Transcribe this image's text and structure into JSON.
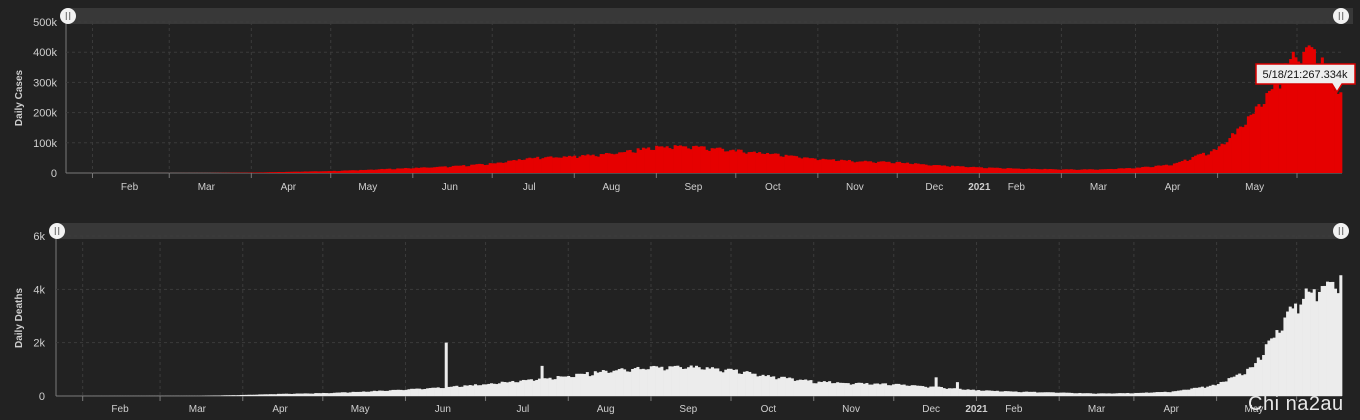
{
  "chart_data": [
    {
      "type": "bar",
      "ylabel": "Daily Cases",
      "ylim": [
        0,
        500000
      ],
      "yticks": [
        {
          "v": 0,
          "label": "0"
        },
        {
          "v": 100000,
          "label": "100k"
        },
        {
          "v": 200000,
          "label": "200k"
        },
        {
          "v": 300000,
          "label": "300k"
        },
        {
          "v": 400000,
          "label": "400k"
        },
        {
          "v": 500000,
          "label": "500k"
        }
      ],
      "xticks": [
        "Feb",
        "Mar",
        "Apr",
        "May",
        "Jun",
        "Jul",
        "Aug",
        "Sep",
        "Oct",
        "Nov",
        "Dec",
        "2021",
        "Feb",
        "Mar",
        "Apr",
        "May"
      ],
      "xrange": [
        "2020-01-22",
        "2021-05-18"
      ],
      "grid": true,
      "color": "#e60000",
      "tooltip": "5/18/21:267.334k",
      "series": [
        {
          "x": "2020-01-22",
          "y": 0
        },
        {
          "x": "2020-03-01",
          "y": 100
        },
        {
          "x": "2020-03-15",
          "y": 300
        },
        {
          "x": "2020-04-01",
          "y": 1500
        },
        {
          "x": "2020-04-15",
          "y": 4000
        },
        {
          "x": "2020-05-01",
          "y": 6500
        },
        {
          "x": "2020-05-15",
          "y": 11000
        },
        {
          "x": "2020-06-01",
          "y": 17000
        },
        {
          "x": "2020-06-15",
          "y": 22000
        },
        {
          "x": "2020-07-01",
          "y": 32000
        },
        {
          "x": "2020-07-15",
          "y": 50000
        },
        {
          "x": "2020-08-01",
          "y": 57000
        },
        {
          "x": "2020-08-15",
          "y": 65000
        },
        {
          "x": "2020-08-25",
          "y": 78000
        },
        {
          "x": "2020-09-01",
          "y": 88000
        },
        {
          "x": "2020-09-15",
          "y": 90000
        },
        {
          "x": "2020-10-01",
          "y": 75000
        },
        {
          "x": "2020-10-15",
          "y": 65000
        },
        {
          "x": "2020-11-01",
          "y": 48000
        },
        {
          "x": "2020-11-15",
          "y": 40000
        },
        {
          "x": "2020-12-01",
          "y": 36000
        },
        {
          "x": "2020-12-15",
          "y": 26000
        },
        {
          "x": "2021-01-01",
          "y": 19000
        },
        {
          "x": "2021-01-15",
          "y": 15000
        },
        {
          "x": "2021-02-01",
          "y": 12000
        },
        {
          "x": "2021-02-15",
          "y": 12000
        },
        {
          "x": "2021-03-01",
          "y": 17000
        },
        {
          "x": "2021-03-15",
          "y": 28000
        },
        {
          "x": "2021-04-01",
          "y": 80000
        },
        {
          "x": "2021-04-10",
          "y": 150000
        },
        {
          "x": "2021-04-20",
          "y": 260000
        },
        {
          "x": "2021-04-30",
          "y": 385000
        },
        {
          "x": "2021-05-06",
          "y": 414000
        },
        {
          "x": "2021-05-12",
          "y": 360000
        },
        {
          "x": "2021-05-18",
          "y": 267334
        }
      ]
    },
    {
      "type": "bar",
      "ylabel": "Daily Deaths",
      "ylim": [
        0,
        6000
      ],
      "yticks": [
        {
          "v": 0,
          "label": "0"
        },
        {
          "v": 2000,
          "label": "2k"
        },
        {
          "v": 4000,
          "label": "4k"
        },
        {
          "v": 6000,
          "label": "6k"
        }
      ],
      "xticks": [
        "Feb",
        "Mar",
        "Apr",
        "May",
        "Jun",
        "Jul",
        "Aug",
        "Sep",
        "Oct",
        "Nov",
        "Dec",
        "2021",
        "Feb",
        "Mar",
        "Apr",
        "May"
      ],
      "xrange": [
        "2020-01-22",
        "2021-05-18"
      ],
      "grid": true,
      "color": "#ececec",
      "spikes": [
        {
          "x": "2020-06-16",
          "y": 2003
        },
        {
          "x": "2020-07-22",
          "y": 1130
        },
        {
          "x": "2020-12-17",
          "y": 700
        },
        {
          "x": "2020-12-25",
          "y": 520
        }
      ],
      "series": [
        {
          "x": "2020-01-22",
          "y": 0
        },
        {
          "x": "2020-03-15",
          "y": 5
        },
        {
          "x": "2020-04-01",
          "y": 40
        },
        {
          "x": "2020-04-15",
          "y": 80
        },
        {
          "x": "2020-05-01",
          "y": 110
        },
        {
          "x": "2020-05-15",
          "y": 160
        },
        {
          "x": "2020-06-01",
          "y": 250
        },
        {
          "x": "2020-06-15",
          "y": 330
        },
        {
          "x": "2020-07-01",
          "y": 450
        },
        {
          "x": "2020-07-15",
          "y": 600
        },
        {
          "x": "2020-08-01",
          "y": 760
        },
        {
          "x": "2020-08-15",
          "y": 950
        },
        {
          "x": "2020-09-01",
          "y": 1080
        },
        {
          "x": "2020-09-15",
          "y": 1100
        },
        {
          "x": "2020-10-01",
          "y": 1000
        },
        {
          "x": "2020-10-15",
          "y": 760
        },
        {
          "x": "2020-11-01",
          "y": 560
        },
        {
          "x": "2020-11-15",
          "y": 490
        },
        {
          "x": "2020-12-01",
          "y": 450
        },
        {
          "x": "2020-12-15",
          "y": 360
        },
        {
          "x": "2021-01-01",
          "y": 220
        },
        {
          "x": "2021-01-15",
          "y": 170
        },
        {
          "x": "2021-02-01",
          "y": 130
        },
        {
          "x": "2021-02-15",
          "y": 95
        },
        {
          "x": "2021-03-01",
          "y": 110
        },
        {
          "x": "2021-03-15",
          "y": 160
        },
        {
          "x": "2021-04-01",
          "y": 420
        },
        {
          "x": "2021-04-15",
          "y": 1100
        },
        {
          "x": "2021-04-25",
          "y": 2600
        },
        {
          "x": "2021-05-01",
          "y": 3500
        },
        {
          "x": "2021-05-08",
          "y": 4100
        },
        {
          "x": "2021-05-15",
          "y": 4300
        },
        {
          "x": "2021-05-18",
          "y": 4529
        }
      ]
    }
  ],
  "watermark": "Chi na2au"
}
